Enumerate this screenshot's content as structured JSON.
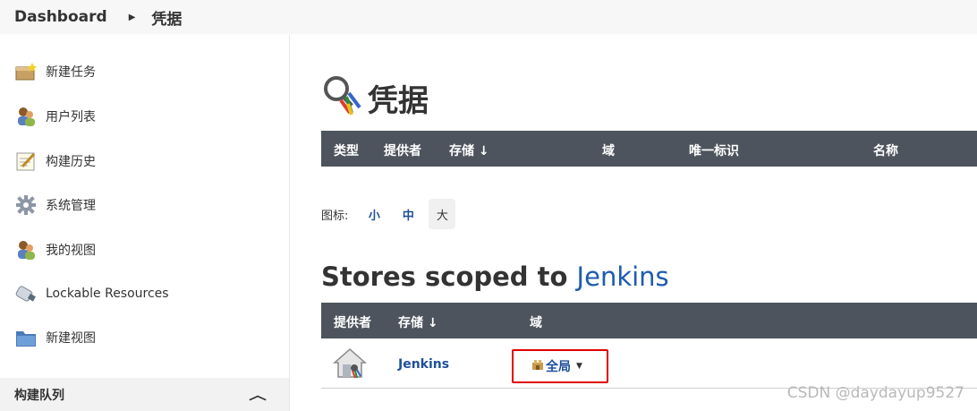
{
  "breadcrumb": {
    "root": "Dashboard",
    "current": "凭据"
  },
  "sidebar": {
    "items": [
      {
        "label": "新建任务",
        "icon": "new-item-icon"
      },
      {
        "label": "用户列表",
        "icon": "people-icon"
      },
      {
        "label": "构建历史",
        "icon": "notepad-icon"
      },
      {
        "label": "系统管理",
        "icon": "gear-icon"
      },
      {
        "label": "我的视图",
        "icon": "user-icon"
      },
      {
        "label": "Lockable Resources",
        "icon": "usb-icon"
      },
      {
        "label": "新建视图",
        "icon": "folder-icon"
      }
    ],
    "queue_label": "构建队列"
  },
  "main": {
    "title": "凭据",
    "credentials_table": {
      "headers": [
        "类型",
        "提供者",
        "存储 ↓",
        "域",
        "唯一标识",
        "名称"
      ]
    },
    "icon_size": {
      "label": "图标:",
      "small": "小",
      "medium": "中",
      "large": "大"
    },
    "stores": {
      "title_prefix": "Stores scoped to ",
      "title_link": "Jenkins",
      "headers": [
        "提供者",
        "存储 ↓",
        "域"
      ],
      "rows": [
        {
          "store": "Jenkins",
          "domain": "全局"
        }
      ]
    }
  },
  "watermark": "CSDN @daydayup9527",
  "colors": {
    "header_bg": "#4d545d",
    "link": "#1e4f9c",
    "highlight_box": "#e00000"
  }
}
